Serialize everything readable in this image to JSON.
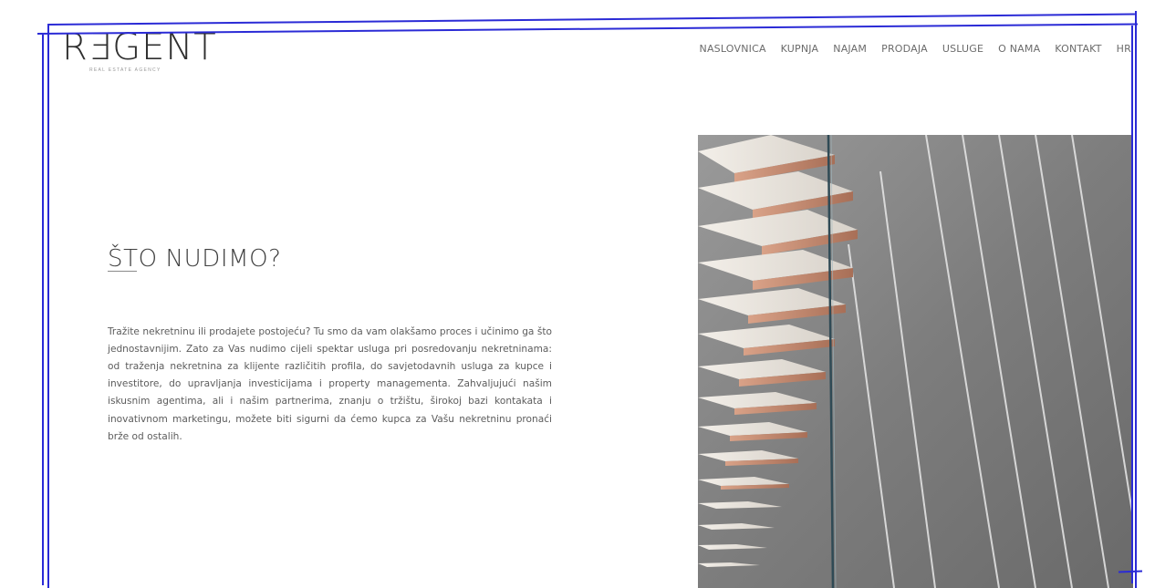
{
  "logo": {
    "text": "RƎGENT",
    "tagline": "REAL ESTATE AGENCY"
  },
  "nav": {
    "items": [
      {
        "label": "NASLOVNICA"
      },
      {
        "label": "KUPNJA"
      },
      {
        "label": "NAJAM"
      },
      {
        "label": "PRODAJA"
      },
      {
        "label": "USLUGE"
      },
      {
        "label": "O NAMA"
      },
      {
        "label": "KONTAKT"
      },
      {
        "label": "HR"
      }
    ]
  },
  "main": {
    "heading": "ŠTO NUDIMO?",
    "paragraph": "Tražite nekretninu ili prodajete postojeću? Tu smo da vam olakšamo proces i učinimo ga što jednostavnijim. Zato za Vas nudimo cijeli spektar usluga pri posredovanju nekretninama: od traženja nekretnina za klijente različitih profila, do savjetodavnih usluga za kupce i investitore, do upravljanja investicijama i property managementa. Zahvaljujući našim iskusnim agentima, ali i našim partnerima, znanju o tržištu, širokoj bazi kontakata i inovativnom marketingu, možete biti sigurni da ćemo kupca za Vašu nekretninu pronaći brže od ostalih."
  },
  "hero": {
    "image_icon": "staircase-photo"
  },
  "colors": {
    "frame": "#2b2bd6",
    "text": "#5c5c5c",
    "heading": "#3f3f3f",
    "stair_wood": "#c9937a",
    "wall": "#8a8a8a"
  }
}
